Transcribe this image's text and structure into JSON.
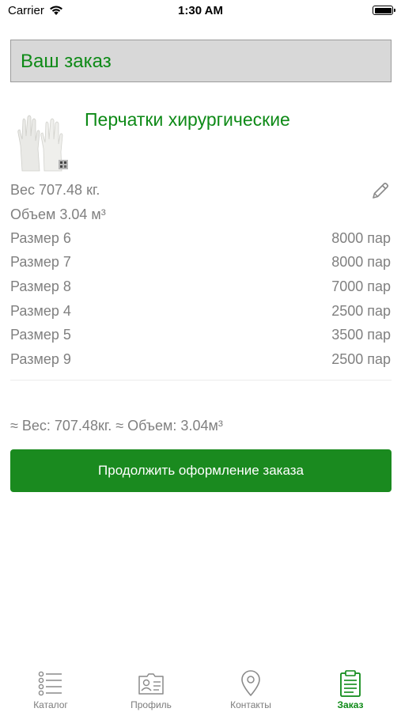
{
  "status_bar": {
    "carrier": "Carrier",
    "time": "1:30 AM"
  },
  "header": {
    "title": "Ваш заказ"
  },
  "colors": {
    "accent": "#0e8a17",
    "button": "#1a8a1f",
    "text": "#808080"
  },
  "product": {
    "name": "Перчатки хирургические",
    "image_icon": "gloves-image",
    "weight": "Вес 707.48 кг.",
    "volume": "Объем 3.04 м³",
    "sizes": [
      {
        "label": "Размер 6",
        "qty": "8000 пар"
      },
      {
        "label": "Размер 7",
        "qty": "8000 пар"
      },
      {
        "label": "Размер 8",
        "qty": "7000 пар"
      },
      {
        "label": "Размер 4",
        "qty": "2500 пар"
      },
      {
        "label": "Размер 5",
        "qty": "3500 пар"
      },
      {
        "label": "Размер 9",
        "qty": "2500 пар"
      }
    ]
  },
  "summary": {
    "totals": "≈ Вес: 707.48кг. ≈ Объем: 3.04м³"
  },
  "actions": {
    "continue_label": "Продолжить оформление заказа"
  },
  "tabbar": {
    "items": [
      {
        "label": "Каталог",
        "icon": "list-icon"
      },
      {
        "label": "Профиль",
        "icon": "id-card-icon"
      },
      {
        "label": "Контакты",
        "icon": "location-pin-icon"
      },
      {
        "label": "Заказ",
        "icon": "clipboard-icon"
      }
    ],
    "active_index": 3
  }
}
